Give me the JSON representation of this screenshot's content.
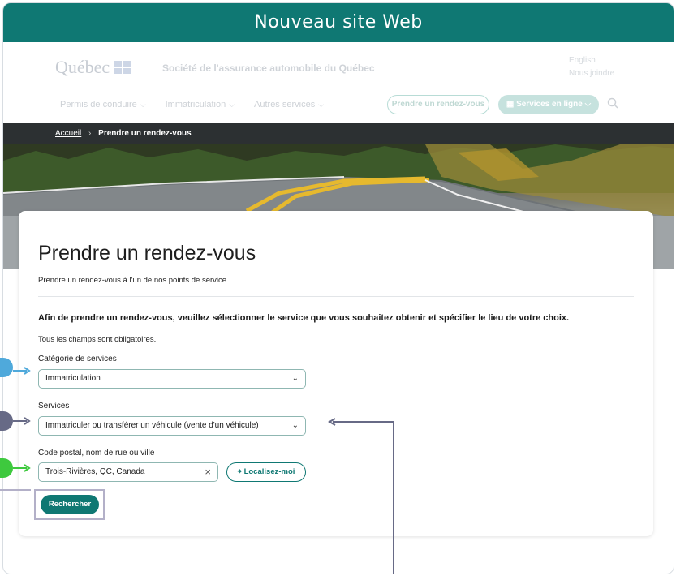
{
  "banner": {
    "title": "Nouveau site Web"
  },
  "header": {
    "logo_text": "Québec",
    "organization": "Société de l'assurance automobile du Québec",
    "lang_link": "English",
    "contact_link": "Nous joindre",
    "nav": [
      {
        "label": "Permis de conduire"
      },
      {
        "label": "Immatriculation"
      },
      {
        "label": "Autres services"
      }
    ],
    "appointment_button": "Prendre un rendez-vous",
    "online_services_button": "Services en ligne"
  },
  "breadcrumb": {
    "home": "Accueil",
    "separator": "›",
    "current": "Prendre un rendez-vous"
  },
  "page": {
    "title": "Prendre un rendez-vous",
    "subtitle": "Prendre un rendez-vous à l'un de nos points de service.",
    "intro": "Afin de prendre un rendez-vous, veuillez sélectionner le service que vous souhaitez obtenir et spécifier le lieu de votre choix.",
    "required_note": "Tous les champs sont obligatoires."
  },
  "form": {
    "category_label": "Catégorie de services",
    "category_value": "Immatriculation",
    "services_label": "Services",
    "services_value": "Immatriculer ou transférer un véhicule (vente d'un véhicule)",
    "location_label": "Code postal, nom de rue ou ville",
    "location_value": "Trois-Rivières, QC, Canada",
    "locate_button": "Localisez-moi",
    "search_button": "Rechercher"
  },
  "colors": {
    "brand_teal": "#0f7873",
    "annotation_blue": "#4fa9db",
    "annotation_slate": "#676a86",
    "annotation_green": "#3ec93e",
    "annotation_lavender": "#b3b0c8"
  }
}
